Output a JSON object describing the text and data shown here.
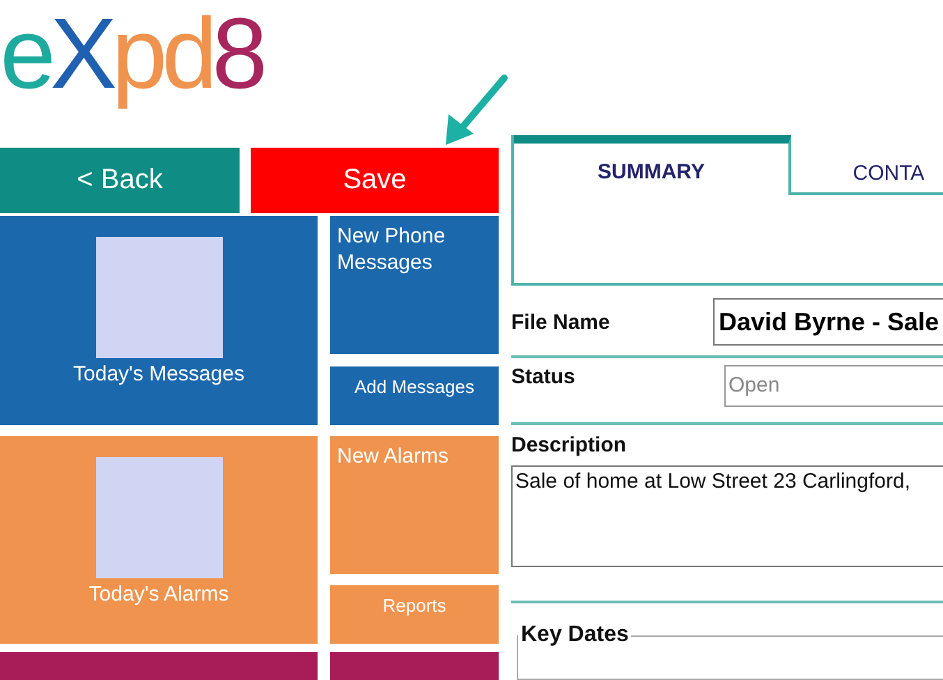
{
  "logo": [
    {
      "text": "e",
      "color": "#1eaa9e"
    },
    {
      "text": "X",
      "color": "#2060b0"
    },
    {
      "text": "pd",
      "color": "#f0934f"
    },
    {
      "text": "8",
      "color": "#a8265e"
    }
  ],
  "nav_buttons": [
    {
      "label": "< Back",
      "kind": "back"
    },
    {
      "label": "Save",
      "kind": "save"
    }
  ],
  "tile_groups": [
    {
      "color": "#1b68ad",
      "main": {
        "label": "Today's Messages"
      },
      "side": [
        {
          "label": "New Phone Messages",
          "kind": "large"
        },
        {
          "label": "Add Messages",
          "kind": "small"
        }
      ]
    },
    {
      "color": "#f0934f",
      "main": {
        "label": "Today's Alarms"
      },
      "side": [
        {
          "label": "New Alarms",
          "kind": "large"
        },
        {
          "label": "Reports",
          "kind": "small"
        }
      ]
    },
    {
      "color": "#a81c58"
    }
  ],
  "tabs": [
    {
      "label": "SUMMARY",
      "selected": true
    },
    {
      "label": "CONTA",
      "selected": false
    }
  ],
  "form": {
    "file_name": {
      "label": "File Name",
      "value": "David Byrne - Sale"
    },
    "status": {
      "label": "Status",
      "value": "Open"
    },
    "description": {
      "label": "Description",
      "value": "Sale of home at Low Street 23 Carlingford,"
    }
  },
  "key_dates": {
    "legend": "Key Dates"
  }
}
